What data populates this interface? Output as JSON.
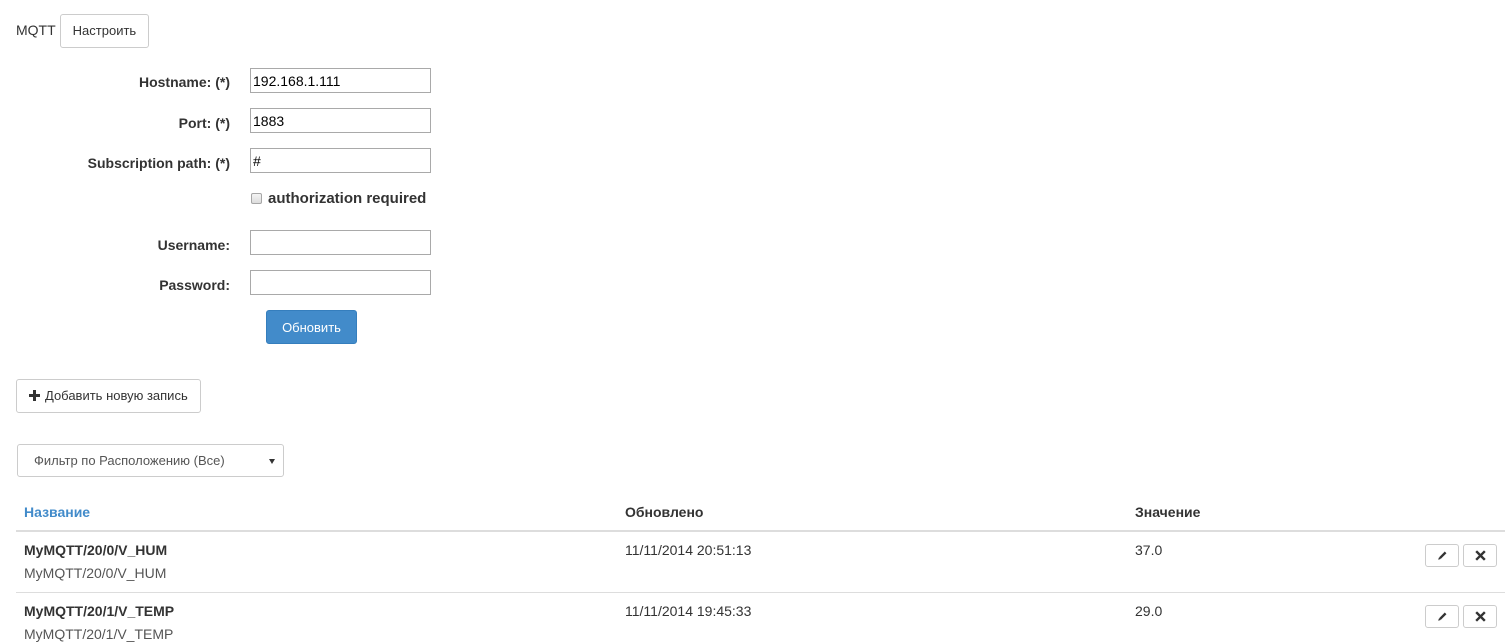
{
  "header": {
    "module_name": "MQTT",
    "configure_label": "Настроить"
  },
  "form": {
    "hostname": {
      "label": "Hostname: (*)",
      "value": "192.168.1.111"
    },
    "port": {
      "label": "Port: (*)",
      "value": "1883"
    },
    "subscription_path": {
      "label": "Subscription path: (*)",
      "value": "#"
    },
    "auth_checkbox": {
      "label": "authorization required",
      "checked": false
    },
    "username": {
      "label": "Username:",
      "value": ""
    },
    "password": {
      "label": "Password:",
      "value": ""
    },
    "update_label": "Обновить"
  },
  "add_record_label": "Добавить новую запись",
  "filter": {
    "selected": "Фильтр по Расположению (Все)"
  },
  "table": {
    "columns": [
      "Название",
      "Обновлено",
      "Значение"
    ],
    "rows": [
      {
        "name": "MyMQTT/20/0/V_HUM",
        "path": "MyMQTT/20/0/V_HUM",
        "updated": "11/11/2014 20:51:13",
        "value": "37.0"
      },
      {
        "name": "MyMQTT/20/1/V_TEMP",
        "path": "MyMQTT/20/1/V_TEMP",
        "updated": "11/11/2014 19:45:33",
        "value": "29.0"
      }
    ]
  },
  "colors": {
    "primary": "#428bca",
    "border": "#dddddd",
    "text": "#333333"
  },
  "icons": {
    "add": "plus-icon",
    "edit": "pencil-icon",
    "delete": "close-icon",
    "select": "caret-down-icon"
  }
}
